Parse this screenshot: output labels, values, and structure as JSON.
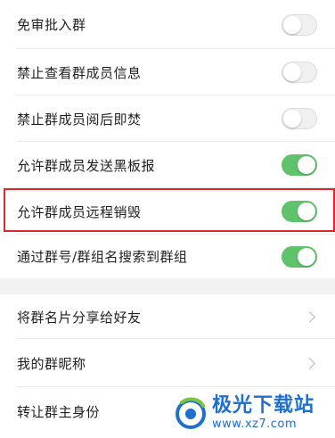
{
  "settings_toggles": [
    {
      "label": "免审批入群",
      "on": false
    },
    {
      "label": "禁止查看群成员信息",
      "on": false
    },
    {
      "label": "禁止群成员阅后即焚",
      "on": false
    },
    {
      "label": "允许群成员发送黑板报",
      "on": true
    },
    {
      "label": "允许群成员远程销毁",
      "on": true
    },
    {
      "label": "通过群号/群组名搜索到群组",
      "on": true
    }
  ],
  "nav_items": [
    {
      "label": "将群名片分享给好友"
    },
    {
      "label": "我的群昵称"
    },
    {
      "label": "转让群主身份"
    }
  ],
  "watermark": {
    "title": "极光下载站",
    "url": "www.xz7.com"
  },
  "colors": {
    "toggle_on": "#5ec36a",
    "highlight": "#e4242b",
    "watermark": "#1e6fd0"
  }
}
